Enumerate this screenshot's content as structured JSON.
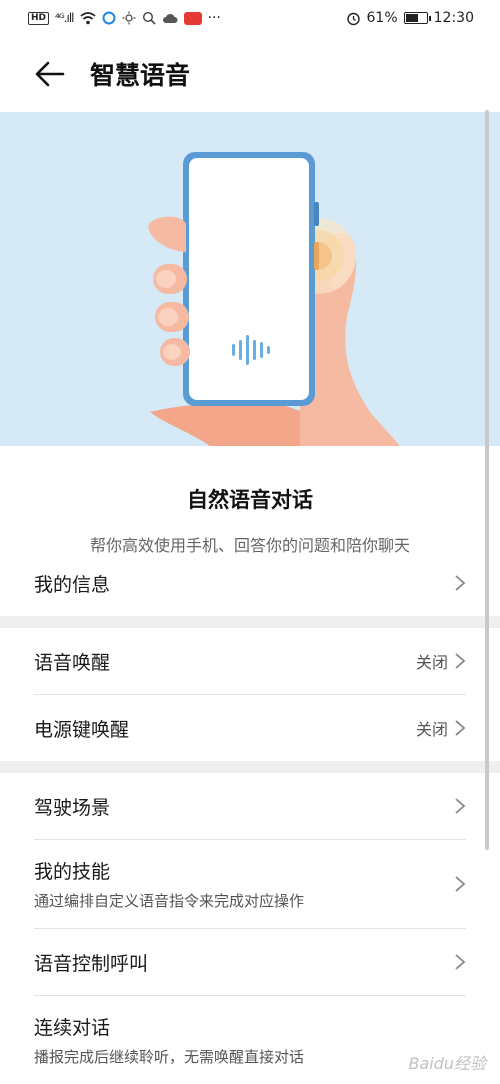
{
  "status_bar": {
    "hd": "HD",
    "signal": "⁴ᴳ.ıll",
    "battery_percent": "61%",
    "battery_level": 0.61,
    "time": "12:30",
    "more": "···"
  },
  "header": {
    "title": "智慧语音"
  },
  "hero": {
    "title": "自然语音对话",
    "subtitle": "帮你高效使用手机、回答你的问题和陪你聊天"
  },
  "list": {
    "my_info": {
      "label": "我的信息"
    },
    "voice_wake": {
      "label": "语音唤醒",
      "value": "关闭"
    },
    "power_wake": {
      "label": "电源键唤醒",
      "value": "关闭"
    },
    "driving": {
      "label": "驾驶场景"
    },
    "my_skills": {
      "label": "我的技能",
      "desc": "通过编排自定义语音指令来完成对应操作"
    },
    "voice_call": {
      "label": "语音控制呼叫"
    },
    "continuous": {
      "label": "连续对话",
      "desc": "播报完成后继续聆听，无需唤醒直接对话"
    }
  },
  "watermark": "Baidu经验",
  "colors": {
    "hero_bg": "#d6e9f7",
    "phone_frame": "#5b9bd5",
    "skin": "#f6b9a1"
  }
}
